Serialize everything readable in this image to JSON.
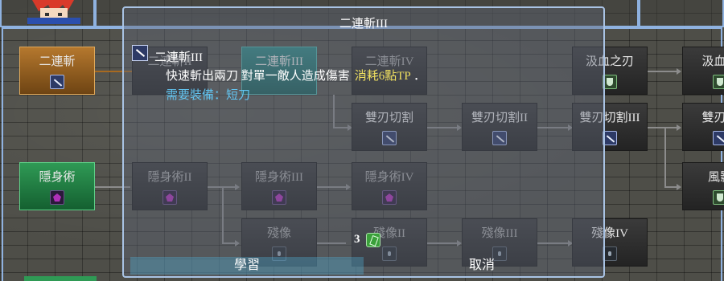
{
  "window": {
    "title": "二連斬III",
    "skill_name": "二連斬III",
    "description": "快速斬出兩刀 對單一敵人造成傷害",
    "cost": "消耗6點TP",
    "cost_suffix": "．",
    "requirement": "需要裝備：短刀",
    "learn_button": "學習",
    "cancel_button": "取消"
  },
  "tree": {
    "row1": [
      "二連斬",
      "二連斬II",
      "二連斬III",
      "二連斬IV",
      "汲血之刃",
      "汲血之"
    ],
    "row2": [
      "雙刃切割",
      "雙刃切割II",
      "雙刃切割III",
      "雙刃切"
    ],
    "row3": [
      "隱身術",
      "隱身術II",
      "隱身術III",
      "隱身術IV",
      "風影"
    ],
    "row4": [
      "殘像",
      "殘像II",
      "殘像III",
      "殘像IV"
    ]
  },
  "counter": {
    "value": "3"
  },
  "colors": {
    "frame": "#8fb2e0",
    "owned_sword": "#b5782e",
    "owned_stealth": "#2f9a55",
    "selected": "#2f8a86",
    "cost": "#f0e060",
    "requirement": "#62c4f0"
  },
  "icons": [
    "blade-icon",
    "shield-icon",
    "purple-mask-icon",
    "ghost-icon",
    "gem-icon"
  ]
}
